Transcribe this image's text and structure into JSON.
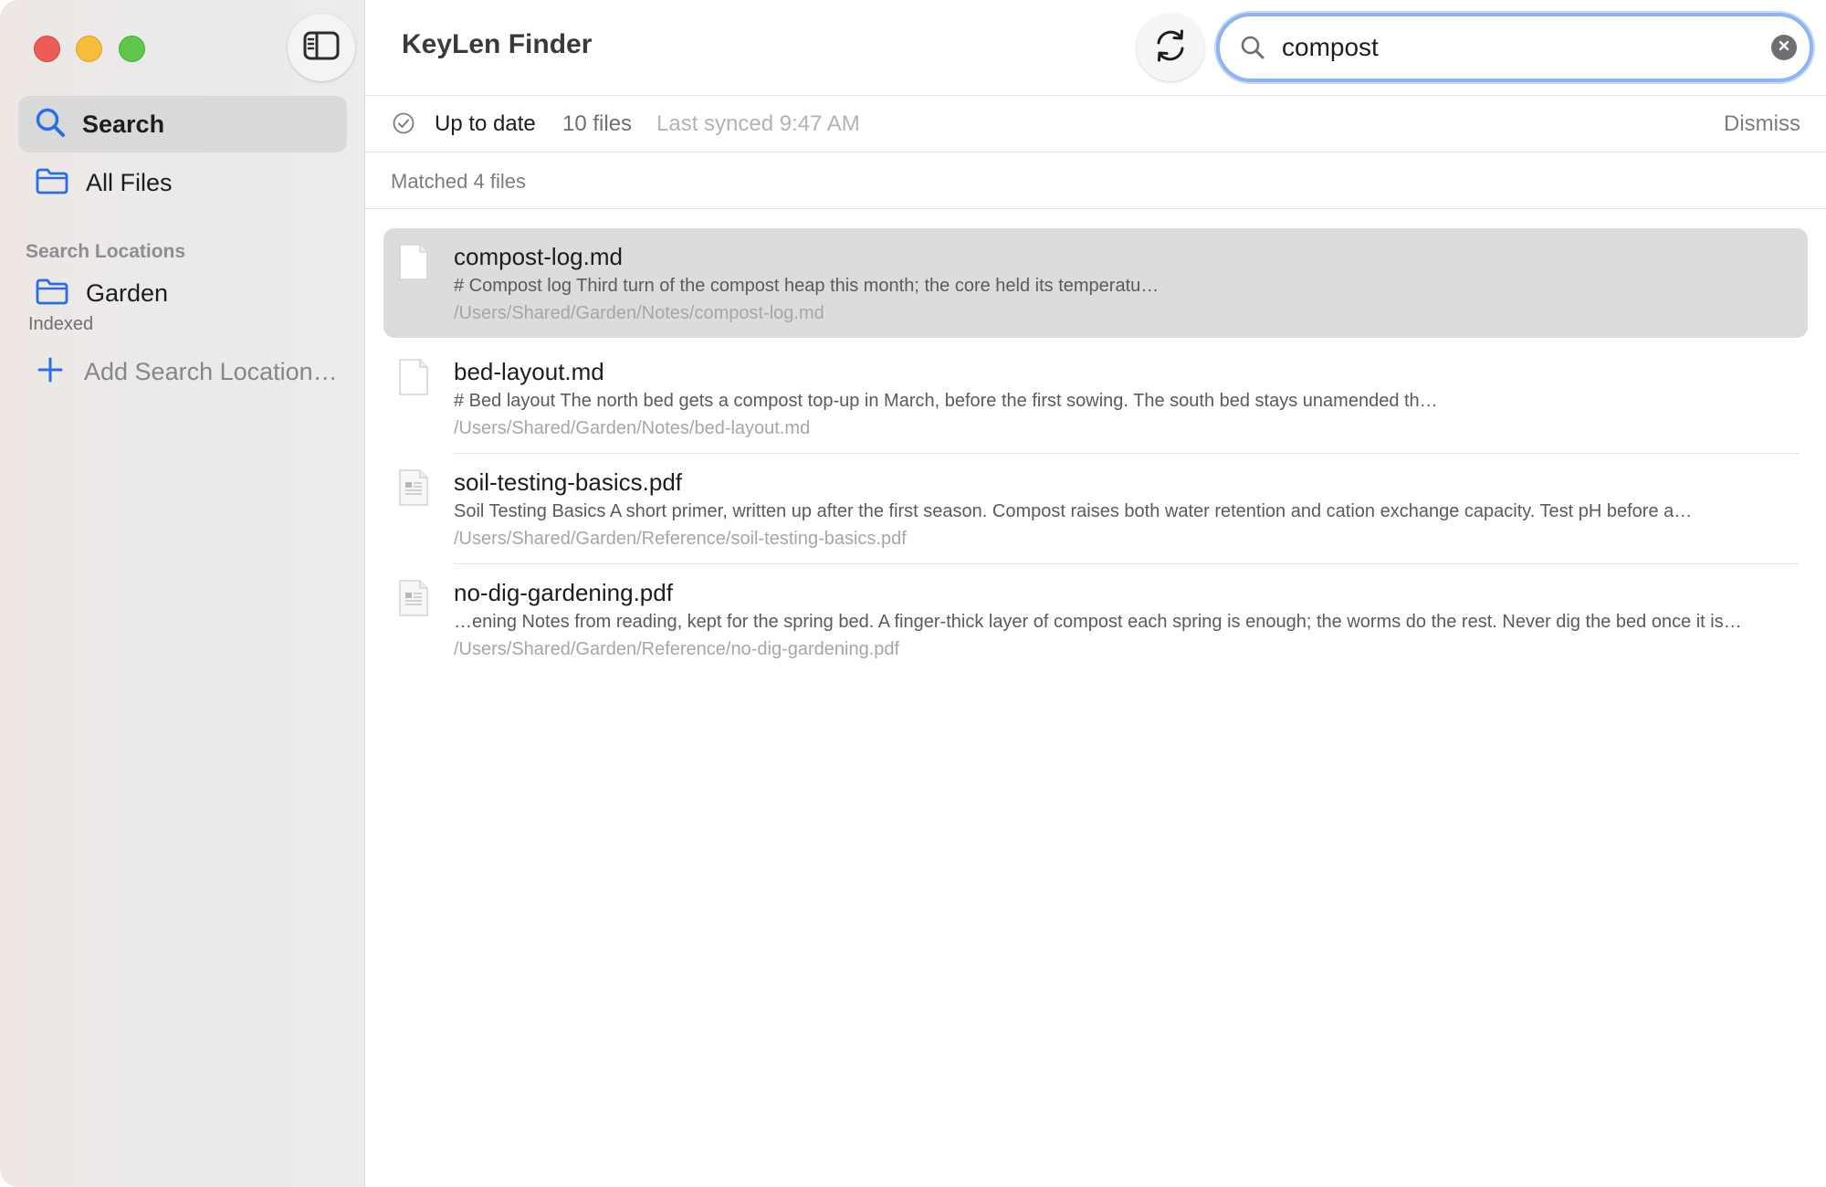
{
  "window": {
    "title": "KeyLen Finder"
  },
  "sidebar": {
    "nav": [
      {
        "label": "Search",
        "icon": "magnifying-glass-icon",
        "selected": true
      },
      {
        "label": "All Files",
        "icon": "folder-icon",
        "selected": false
      }
    ],
    "section_title": "Search Locations",
    "locations": [
      {
        "label": "Garden",
        "status": "Indexed",
        "icon": "folder-icon"
      }
    ],
    "add_location_label": "Add Search Location…"
  },
  "toolbar": {
    "refresh_icon": "refresh-icon",
    "search": {
      "value": "compost",
      "placeholder": ""
    }
  },
  "status": {
    "state": "Up to date",
    "file_count": "10 files",
    "last_synced": "Last synced 9:47 AM",
    "dismiss_label": "Dismiss"
  },
  "results": {
    "summary": "Matched 4 files",
    "items": [
      {
        "name": "compost-log.md",
        "snippet": "# Compost log Third turn of the compost heap this month; the core held its temperatu…",
        "path": "/Users/Shared/Garden/Notes/compost-log.md",
        "kind": "markdown",
        "selected": true
      },
      {
        "name": "bed-layout.md",
        "snippet": "# Bed layout The north bed gets a compost top-up in March, before the first sowing. The south bed stays unamended th…",
        "path": "/Users/Shared/Garden/Notes/bed-layout.md",
        "kind": "markdown",
        "selected": false
      },
      {
        "name": "soil-testing-basics.pdf",
        "snippet": "Soil Testing Basics A short primer, written up after the first season. Compost raises both water retention and cation exchange capacity. Test pH before a…",
        "path": "/Users/Shared/Garden/Reference/soil-testing-basics.pdf",
        "kind": "pdf",
        "selected": false
      },
      {
        "name": "no-dig-gardening.pdf",
        "snippet": "…ening Notes from reading, kept for the spring bed. A finger-thick layer of compost each spring is enough; the worms do the rest. Never dig the bed once it is…",
        "path": "/Users/Shared/Garden/Reference/no-dig-gardening.pdf",
        "kind": "pdf",
        "selected": false
      }
    ]
  },
  "colors": {
    "accent": "#2a6ee6",
    "selection": "#dcdcdc",
    "close": "#ee5c56",
    "minimize": "#f6bd3b",
    "zoom": "#5fc54b"
  }
}
